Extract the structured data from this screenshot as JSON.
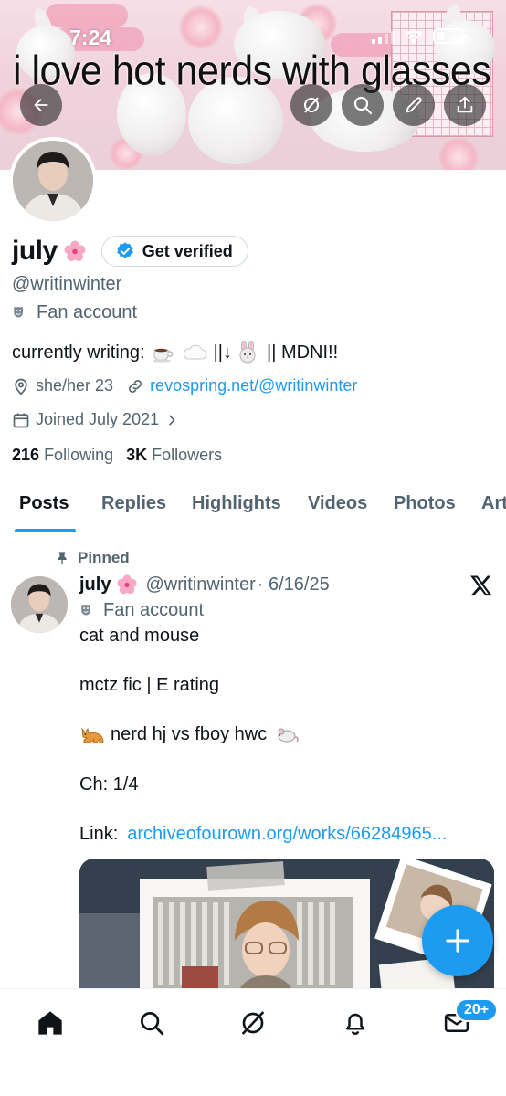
{
  "status_bar": {
    "time": "7:24"
  },
  "banner": {
    "text": "i love hot nerds with glasses"
  },
  "profile": {
    "display_name": "july",
    "verify_label": "Get verified",
    "handle": "@writinwinter",
    "account_label": "Fan account",
    "bio_prefix": "currently writing:",
    "bio_mid": "||↓",
    "bio_suffix": "|| MDNI!!",
    "pronouns": "she/her 23",
    "website": "revospring.net/@writinwinter",
    "joined": "Joined July 2021",
    "following_count": "216",
    "following_label": "Following",
    "followers_count": "3K",
    "followers_label": "Followers"
  },
  "tabs": [
    {
      "label": "Posts"
    },
    {
      "label": "Replies"
    },
    {
      "label": "Highlights"
    },
    {
      "label": "Videos"
    },
    {
      "label": "Photos"
    },
    {
      "label": "Art"
    }
  ],
  "pinned_post": {
    "pinned_label": "Pinned",
    "author_name": "july",
    "author_handle": "@writinwinter",
    "date": "· 6/16/25",
    "account_label": "Fan account",
    "title": "cat and mouse",
    "rating_line": "mctz fic | E rating",
    "summary_line": "nerd hj vs fboy hwc",
    "chapter_line": "Ch: 1/4",
    "link_label": "Link:",
    "link_url": "archiveofourown.org/works/66284965..."
  },
  "bottom_nav": {
    "items": [
      "home-icon",
      "search-icon",
      "grok-icon",
      "notifications-icon",
      "messages-icon"
    ],
    "messages_badge": "20+"
  },
  "colors": {
    "accent": "#1d9bf0",
    "text": "#0f1419",
    "secondary": "#536471"
  }
}
